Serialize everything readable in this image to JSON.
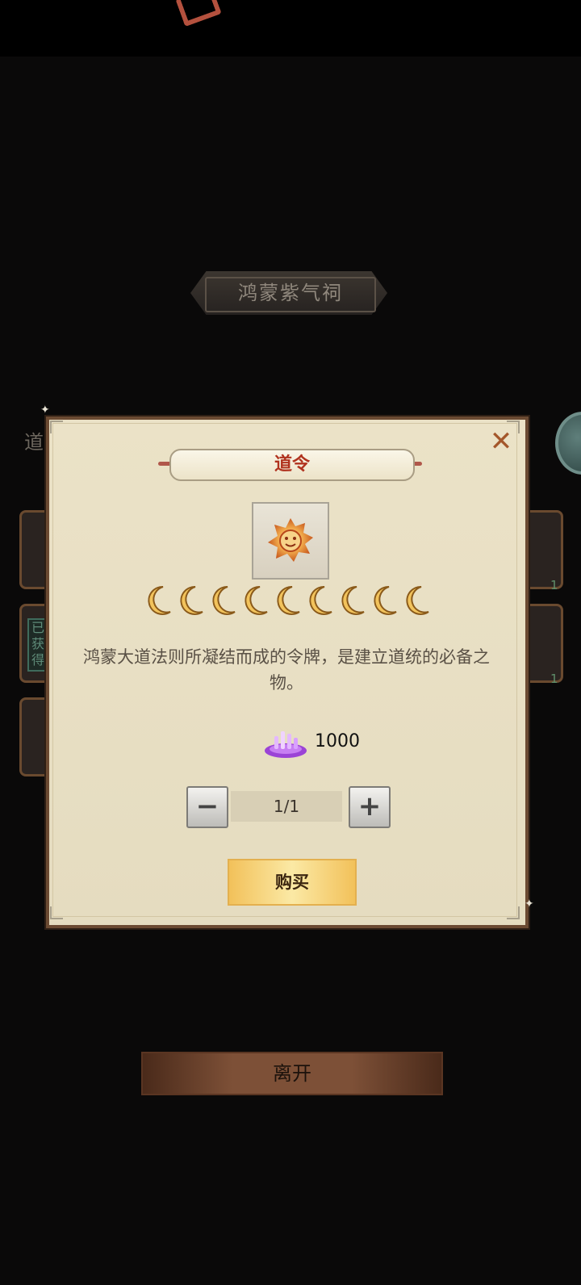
{
  "shrine": {
    "title": "鸿蒙紫气祠"
  },
  "background": {
    "section_label": "道",
    "obtained_stamp": "已获得",
    "counts": [
      "1",
      "1"
    ]
  },
  "dialog": {
    "title": "道令",
    "close_icon": "close-icon",
    "item_icon": "token-icon",
    "rating_count": 9,
    "rating_icon": "crescent-moon-icon",
    "description": "鸿蒙大道法则所凝结而成的令牌，是建立道统的必备之物。",
    "price": {
      "currency_icon": "purple-crystal-icon",
      "value": "1000"
    },
    "quantity": {
      "minus_label": "−",
      "value": "1/1",
      "plus_label": "+"
    },
    "buy_label": "购买"
  },
  "footer": {
    "leave_label": "离开"
  },
  "colors": {
    "title_red": "#b0321e",
    "panel_bg": "#e5dcc0",
    "border_brown": "#6b4a32",
    "buy_gold": "#f2c15a"
  }
}
